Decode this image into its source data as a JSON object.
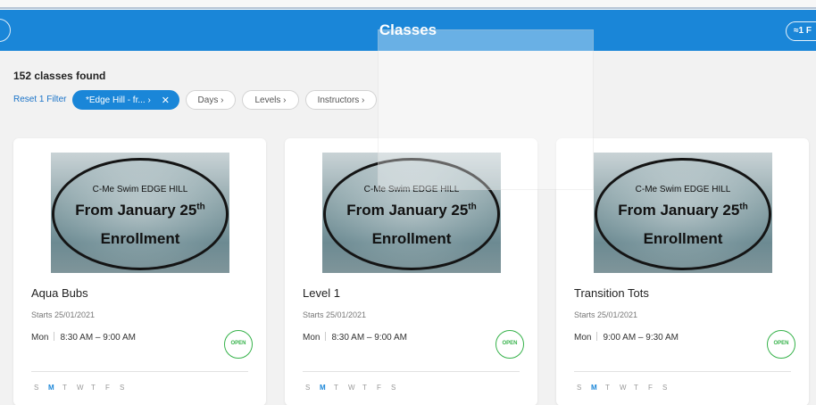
{
  "header": {
    "title": "Classes",
    "filter_label": "≈1 F"
  },
  "summary": {
    "found": "152 classes found",
    "reset": "Reset 1 Filter"
  },
  "filters": [
    {
      "label": "*Edge Hill - fr...  ›",
      "clear": "✕"
    },
    {
      "label": "Days ›"
    },
    {
      "label": "Levels ›"
    },
    {
      "label": "Instructors ›"
    }
  ],
  "banner": {
    "line1": "C-Me Swim EDGE HILL",
    "line2": "From January 25",
    "line2_sup": "th",
    "line3": "Enrollment"
  },
  "cards": [
    {
      "title": "Aqua Bubs",
      "starts": "Starts 25/01/2021",
      "day": "Mon",
      "time": "8:30 AM – 9:00 AM",
      "status": "OPEN"
    },
    {
      "title": "Level 1",
      "starts": "Starts 25/01/2021",
      "day": "Mon",
      "time": "8:30 AM – 9:00 AM",
      "status": "OPEN"
    },
    {
      "title": "Transition Tots",
      "starts": "Starts 25/01/2021",
      "day": "Mon",
      "time": "9:00 AM – 9:30 AM",
      "status": "OPEN"
    }
  ],
  "days": [
    "S",
    "M",
    "T",
    "W",
    "T",
    "F",
    "S"
  ],
  "colors": {
    "header": "#1a86d8",
    "open": "#36b24a",
    "active_day": "#1a86d8"
  }
}
